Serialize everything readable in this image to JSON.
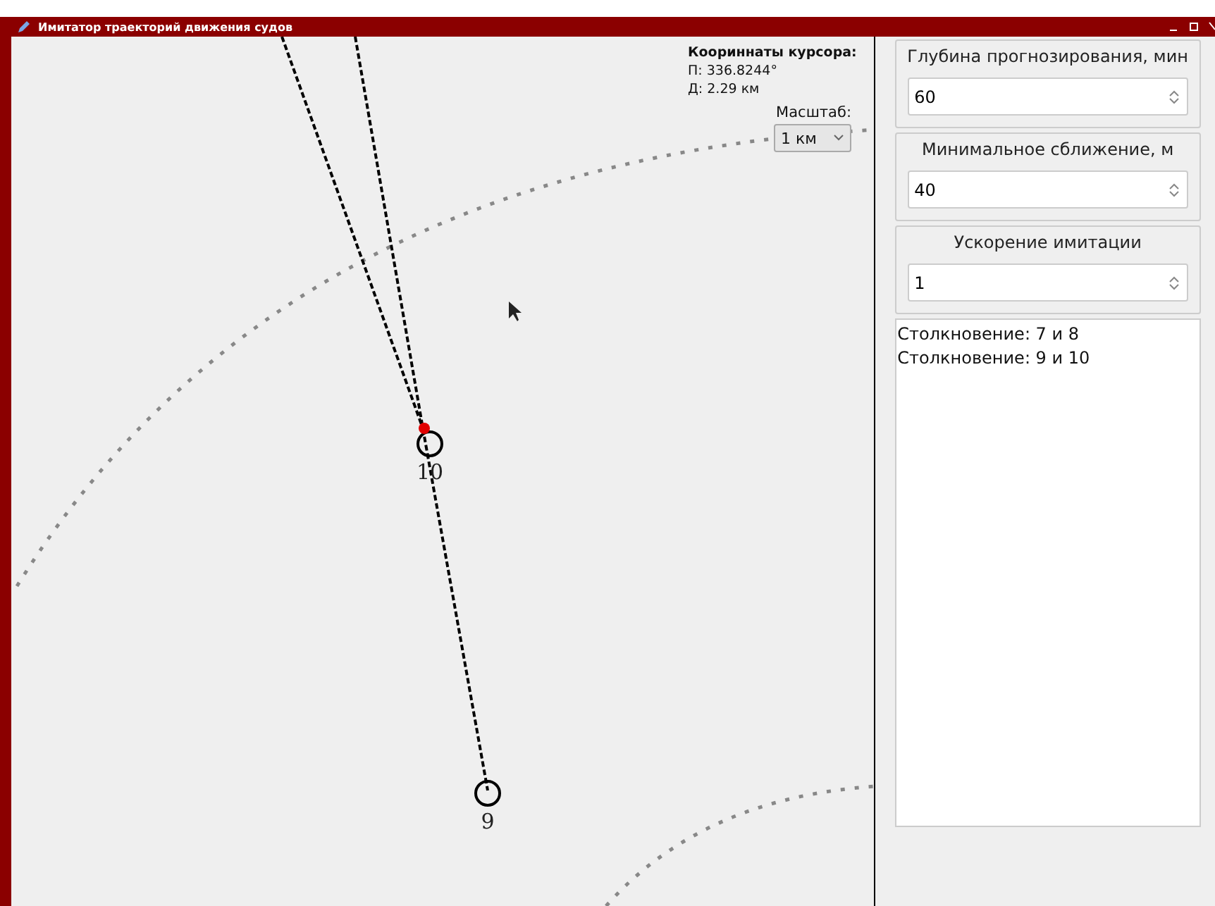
{
  "window": {
    "title": "Имитатор траекторий движения судов"
  },
  "canvas": {
    "cursor_info": {
      "heading": "Коориннаты курсора:",
      "bearing": "П: 336.8244°",
      "distance": "Д: 2.29 км"
    },
    "scale": {
      "label": "Масштаб:",
      "value": "1 км"
    },
    "ships": [
      {
        "label": "10",
        "danger": true
      },
      {
        "label": "9",
        "danger": false
      }
    ]
  },
  "settings": [
    {
      "title": "Глубина прогнозирования, мин",
      "value": "60"
    },
    {
      "title": "Минимальное сближение, м",
      "value": "40"
    },
    {
      "title": "Ускорение имитации",
      "value": "1"
    }
  ],
  "log": [
    "Столкновение: 7 и 8",
    "Столкновение: 9 и 10"
  ]
}
